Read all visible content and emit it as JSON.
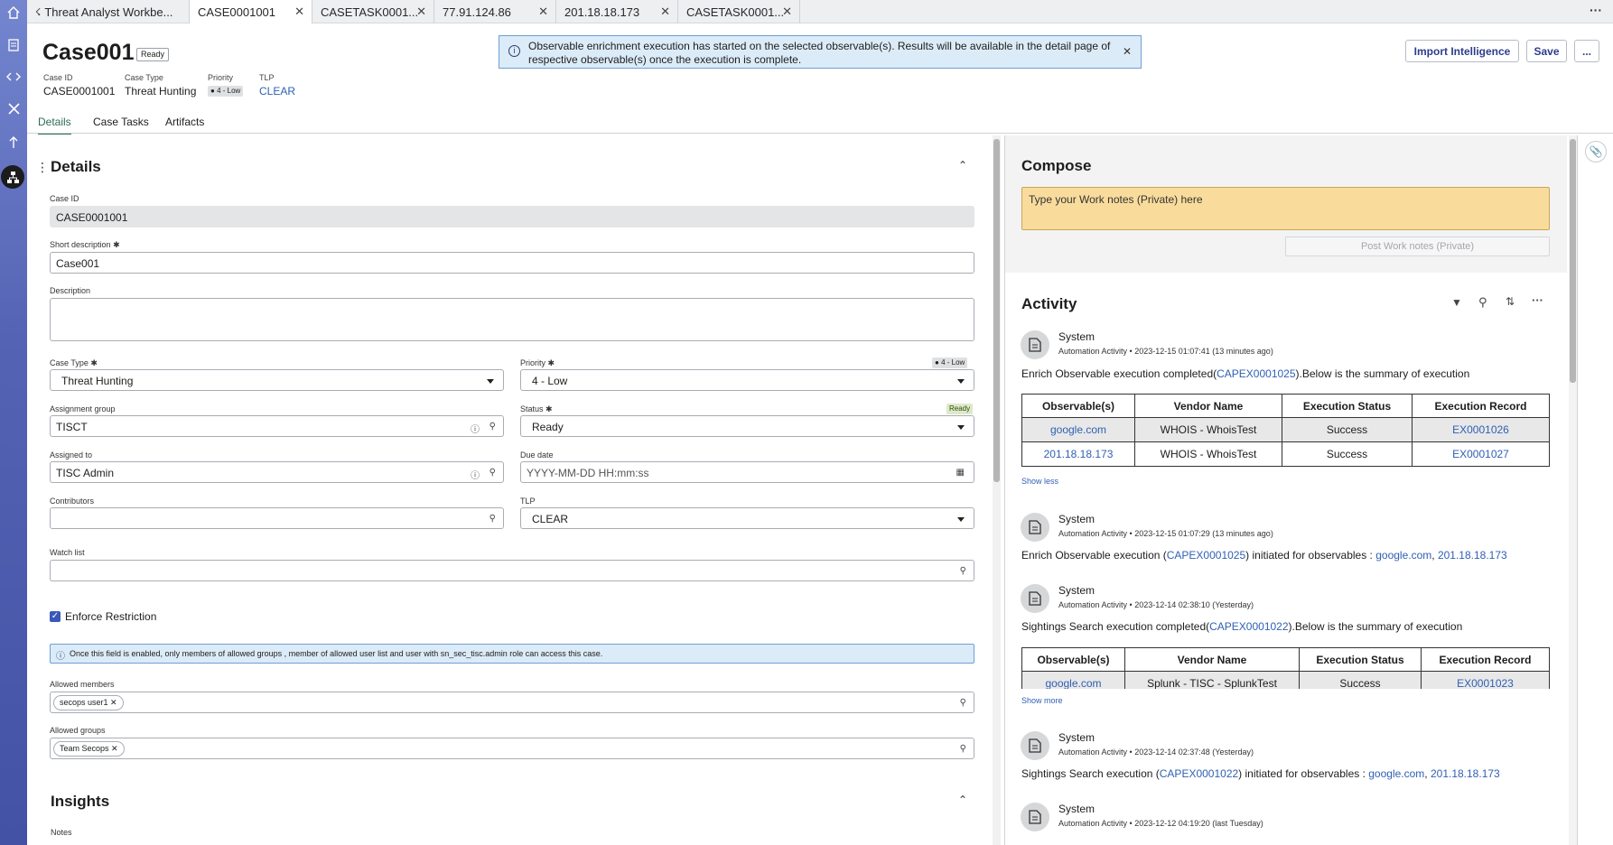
{
  "window_tabs": [
    {
      "label": "Threat Analyst Workbe..."
    },
    {
      "label": "CASE0001001"
    },
    {
      "label": "CASETASK0001..."
    },
    {
      "label": "77.91.124.86"
    },
    {
      "label": "201.18.18.173"
    },
    {
      "label": "CASETASK0001..."
    }
  ],
  "header": {
    "title": "Case001",
    "state_badge": "Ready",
    "fields": [
      {
        "label": "Case ID",
        "value": "CASE0001001"
      },
      {
        "label": "Case Type",
        "value": "Threat Hunting"
      },
      {
        "label": "Priority",
        "value": "4 - Low"
      },
      {
        "label": "TLP",
        "value": "CLEAR"
      }
    ],
    "import_button": "Import Intelligence",
    "save_button": "Save",
    "more_button": "..."
  },
  "notification": {
    "text_line1": "Observable enrichment execution has started on the selected observable(s). Results will be available in the detail page of",
    "text_line2": "respective observable(s) once the execution is complete."
  },
  "subtabs": [
    "Details",
    "Case Tasks",
    "Artifacts"
  ],
  "details": {
    "section_title": "Details",
    "case_id": {
      "label": "Case ID",
      "value": "CASE0001001"
    },
    "short_description": {
      "label": "Short description",
      "value": "Case001"
    },
    "description": {
      "label": "Description",
      "value": ""
    },
    "case_type": {
      "label": "Case Type",
      "value": "Threat Hunting"
    },
    "priority": {
      "label": "Priority",
      "value": "4 - Low",
      "badge": "4 - Low"
    },
    "assignment_group": {
      "label": "Assignment group",
      "value": "TISCT"
    },
    "status": {
      "label": "Status",
      "value": "Ready",
      "badge": "Ready"
    },
    "assigned_to": {
      "label": "Assigned to",
      "value": "TISC Admin"
    },
    "due_date": {
      "label": "Due date",
      "placeholder": "YYYY-MM-DD HH:mm:ss"
    },
    "contributors": {
      "label": "Contributors",
      "value": ""
    },
    "tlp": {
      "label": "TLP",
      "value": "CLEAR"
    },
    "watch_list": {
      "label": "Watch list",
      "value": ""
    },
    "enforce_restriction": {
      "label": "Enforce Restriction",
      "checked": true
    },
    "restriction_info": "Once this field is enabled, only members of allowed groups , member of allowed user list and user with sn_sec_tisc.admin role can access this case.",
    "allowed_members": {
      "label": "Allowed members",
      "chips": [
        "secops user1"
      ]
    },
    "allowed_groups": {
      "label": "Allowed groups",
      "chips": [
        "Team Secops"
      ]
    },
    "insights_title": "Insights",
    "notes_label": "Notes"
  },
  "compose": {
    "title": "Compose",
    "placeholder": "Type your Work notes (Private) here",
    "post_button": "Post Work notes (Private)"
  },
  "activity": {
    "title": "Activity",
    "entries": [
      {
        "author": "System",
        "meta_type": "Automation Activity",
        "meta_time": "2023-12-15 01:07:41 (13 minutes ago)",
        "text_prefix": "Enrich Observable execution completed(",
        "link": "CAPEX0001025",
        "text_suffix": ").Below is the summary of execution",
        "table": {
          "headers": [
            "Observable(s)",
            "Vendor Name",
            "Execution Status",
            "Execution Record"
          ],
          "rows": [
            [
              "google.com",
              "WHOIS - WhoisTest",
              "Success",
              "EX0001026"
            ],
            [
              "201.18.18.173",
              "WHOIS - WhoisTest",
              "Success",
              "EX0001027"
            ]
          ]
        },
        "toggle": "Show less"
      },
      {
        "author": "System",
        "meta_type": "Automation Activity",
        "meta_time": "2023-12-15 01:07:29 (13 minutes ago)",
        "text_prefix": "Enrich Observable execution (",
        "link": "CAPEX0001025",
        "text_suffix": ") initiated for observables : ",
        "obs1": "google.com",
        "obs2": "201.18.18.173"
      },
      {
        "author": "System",
        "meta_type": "Automation Activity",
        "meta_time": "2023-12-14 02:38:10 (Yesterday)",
        "text_prefix": "Sightings Search execution completed(",
        "link": "CAPEX0001022",
        "text_suffix": ").Below is the summary of execution",
        "table": {
          "headers": [
            "Observable(s)",
            "Vendor Name",
            "Execution Status",
            "Execution Record"
          ],
          "rows": [
            [
              "google.com",
              "Splunk - TISC - SplunkTest",
              "Success",
              "EX0001023"
            ]
          ]
        },
        "toggle": "Show more"
      },
      {
        "author": "System",
        "meta_type": "Automation Activity",
        "meta_time": "2023-12-14 02:37:48 (Yesterday)",
        "text_prefix": "Sightings Search execution (",
        "link": "CAPEX0001022",
        "text_suffix": ") initiated for observables : ",
        "obs1": "google.com",
        "obs2": "201.18.18.173"
      },
      {
        "author": "System",
        "meta_type": "Automation Activity",
        "meta_time": "2023-12-12 04:19:20 (last Tuesday)"
      }
    ]
  },
  "colors": {
    "accent": "#2f5fb3",
    "rail": "#5563b4",
    "compose_bg": "#f9dc9c",
    "notice_bg": "#dcebf8"
  },
  "icons": [
    "home-icon",
    "document-icon",
    "code-icon",
    "tools-icon",
    "upload-icon",
    "workflow-icon",
    "paperclip-icon",
    "filter-icon",
    "search-icon",
    "sort-icon",
    "more-icon",
    "info-icon",
    "close-icon",
    "calendar-icon",
    "chevron-up-icon",
    "checkbox-icon"
  ]
}
